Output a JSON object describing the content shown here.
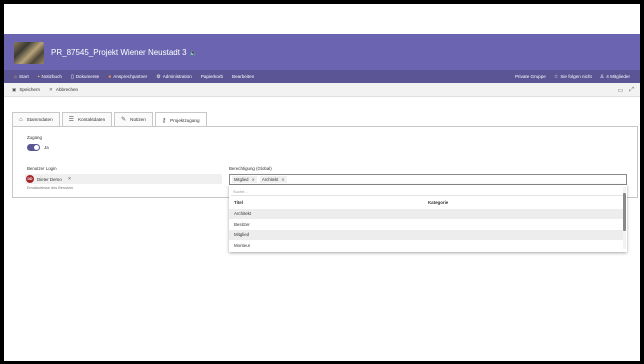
{
  "header": {
    "title": "PR_87545_Projekt Wiener Neustadt 3",
    "title_icon": "speaker-icon"
  },
  "nav": {
    "items": [
      {
        "label": "Start",
        "icon": "home-icon"
      },
      {
        "label": "Notizbuch",
        "icon": "notebook-icon"
      },
      {
        "label": "Dokumente",
        "icon": "document-icon"
      },
      {
        "label": "Ansprechpartner",
        "icon": "contacts-icon"
      },
      {
        "label": "Administration",
        "icon": "gear-icon"
      },
      {
        "label": "Papierkorb",
        "icon": ""
      },
      {
        "label": "Bearbeiten",
        "icon": ""
      }
    ],
    "right": {
      "group": "Private Gruppe",
      "follow": "Sie folgen nicht",
      "members": "4 Mitglieder"
    }
  },
  "commands": {
    "save": "Speichern",
    "cancel": "Abbrechen"
  },
  "tabs": [
    {
      "label": "Stammdaten",
      "icon": "home-icon"
    },
    {
      "label": "Kontaktdaten",
      "icon": "list-icon"
    },
    {
      "label": "Notizen",
      "icon": "edit-icon"
    },
    {
      "label": "Projektzugang",
      "icon": "key-icon"
    }
  ],
  "form": {
    "access_label": "Zugang",
    "access_value": "Ja",
    "user_login_label": "Benutzer Login",
    "user_initials": "DD",
    "user_name": "Dieter Demo",
    "user_hint": "Emailadresse des Benutzer",
    "permission_label": "Berechtigung (Global)",
    "permission_tags": [
      "Mitglied",
      "Architekt"
    ],
    "search_placeholder": "Suche...",
    "dropdown": {
      "col_title": "Titel",
      "col_category": "Kategorie",
      "options": [
        "Architekt",
        "Besitzer",
        "Mitglied",
        "Monteur"
      ]
    }
  },
  "colors": {
    "header": "#6b64b0",
    "navbar": "#5b5495",
    "avatar": "#a4262c"
  }
}
